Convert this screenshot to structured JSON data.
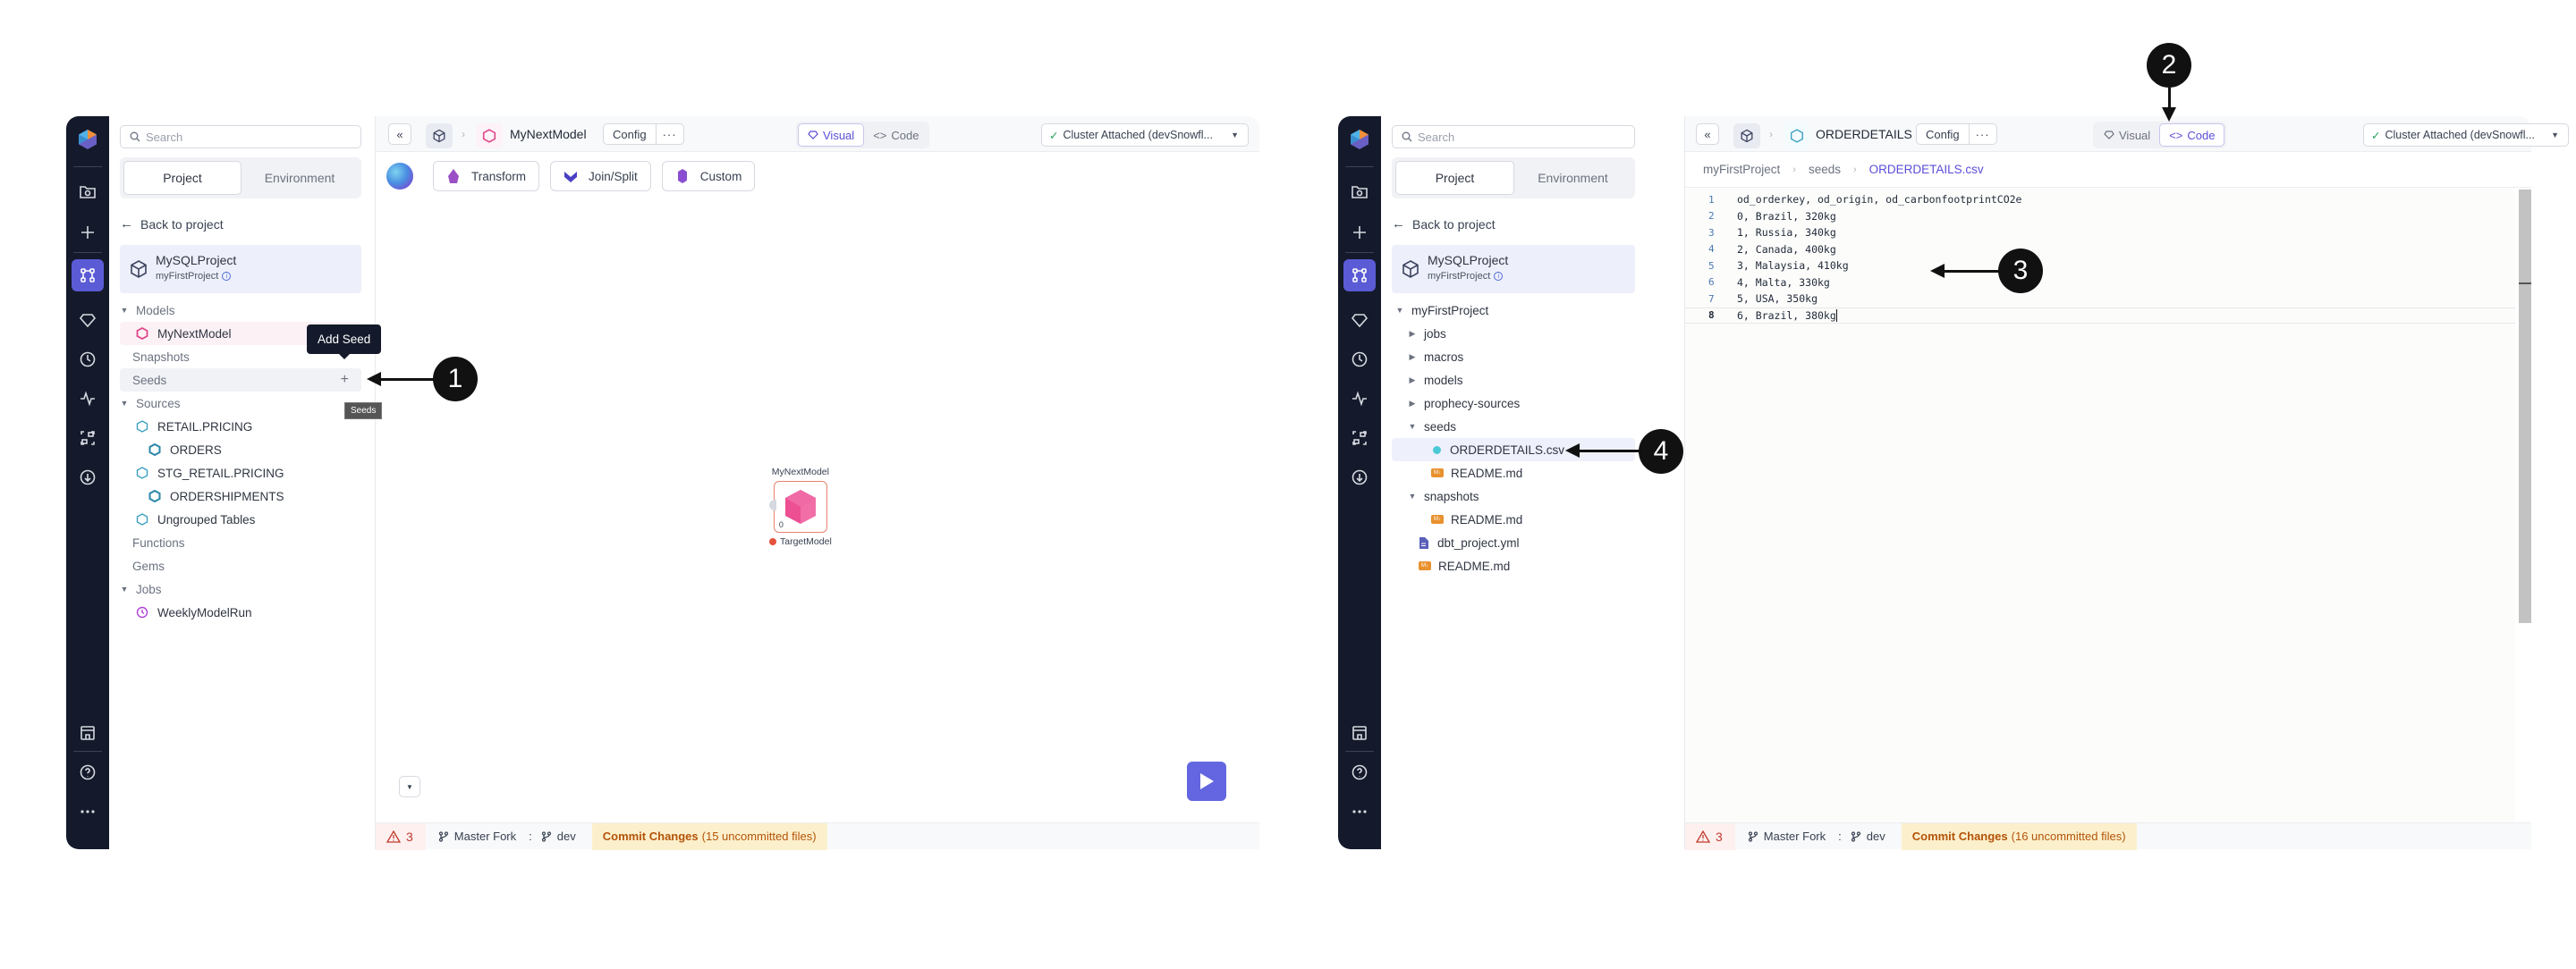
{
  "left_panel": {
    "sidebar": {
      "search_placeholder": "Search",
      "tabs": [
        {
          "label": "Project",
          "active": true
        },
        {
          "label": "Environment",
          "active": false
        }
      ],
      "back_label": "Back to project",
      "project": {
        "name": "MySQLProject",
        "sub": "myFirstProject"
      },
      "tree": {
        "models_label": "Models",
        "model_item": "MyNextModel",
        "snapshots_label": "Snapshots",
        "seeds_label": "Seeds",
        "sources_label": "Sources",
        "sources": [
          "RETAIL.PRICING",
          "ORDERS",
          "STG_RETAIL.PRICING",
          "ORDERSHIPMENTS",
          "Ungrouped Tables"
        ],
        "functions_label": "Functions",
        "gems_label": "Gems",
        "jobs_label": "Jobs",
        "job_item": "WeeklyModelRun"
      },
      "tooltip_add_seed": "Add Seed",
      "tooltip_seeds": "Seeds"
    },
    "topbar": {
      "entity_name": "MyNextModel",
      "config_label": "Config",
      "more_label": "···",
      "visual_label": "Visual",
      "code_label": "Code",
      "active_view": "Visual",
      "cluster_label": "Cluster Attached (devSnowfl..."
    },
    "gems": [
      "Transform",
      "Join/Split",
      "Custom"
    ],
    "node": {
      "label": "MyNextModel",
      "count": "0",
      "tag": "TargetModel"
    },
    "status": {
      "warnings": "3",
      "fork": "Master Fork",
      "branch": "dev",
      "commit_label": "Commit Changes",
      "commit_detail": "(15 uncommitted files)"
    }
  },
  "right_panel": {
    "sidebar": {
      "search_placeholder": "Search",
      "tabs": [
        {
          "label": "Project",
          "active": true
        },
        {
          "label": "Environment",
          "active": false
        }
      ],
      "back_label": "Back to project",
      "project": {
        "name": "MySQLProject",
        "sub": "myFirstProject"
      },
      "tree": {
        "root": "myFirstProject",
        "folders": [
          "jobs",
          "macros",
          "models",
          "prophecy-sources"
        ],
        "seeds_folder": "seeds",
        "seed_file": "ORDERDETAILS.csv",
        "seeds_readme": "README.md",
        "snapshots_folder": "snapshots",
        "snapshots_readme": "README.md",
        "dbt_project": "dbt_project.yml",
        "root_readme": "README.md"
      }
    },
    "topbar": {
      "entity_name": "ORDERDETAILS",
      "config_label": "Config",
      "more_label": "···",
      "visual_label": "Visual",
      "code_label": "Code",
      "active_view": "Code",
      "cluster_label": "Cluster Attached (devSnowfl..."
    },
    "path": [
      "myFirstProject",
      "seeds",
      "ORDERDETAILS.csv"
    ],
    "code_lines": [
      "od_orderkey, od_origin, od_carbonfootprintCO2e",
      "0, Brazil, 320kg",
      "1, Russia, 340kg",
      "2, Canada, 400kg",
      "3, Malaysia, 410kg",
      "4, Malta, 330kg",
      "5, USA, 350kg",
      "6, Brazil, 380kg"
    ],
    "status": {
      "warnings": "3",
      "fork": "Master Fork",
      "branch": "dev",
      "commit_label": "Commit Changes",
      "commit_detail": "(16 uncommitted files)"
    }
  },
  "annotations": [
    "1",
    "2",
    "3",
    "4"
  ],
  "colors": {
    "accent": "#5b5bd6",
    "rail": "#141a2b",
    "model_pink": "#e0468a",
    "source_teal": "#3aa0c0",
    "warning": "#c0392b",
    "commit_bg": "#fcf0cc"
  }
}
